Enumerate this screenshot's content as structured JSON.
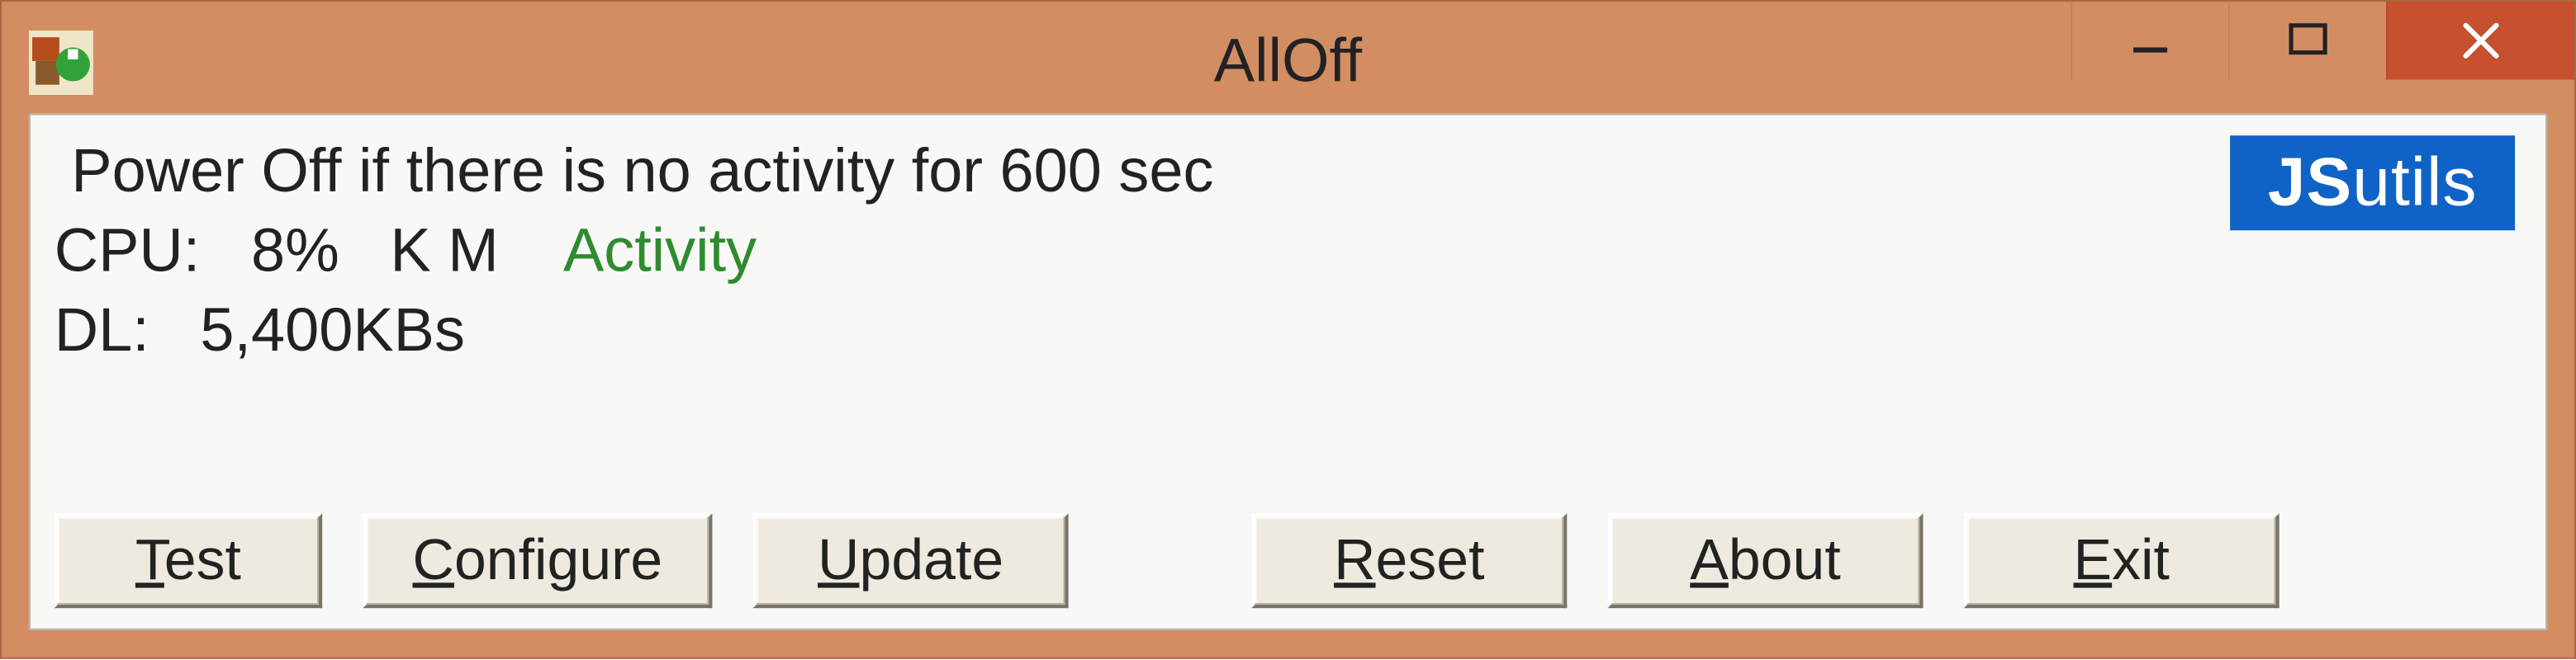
{
  "window": {
    "title": "AllOff"
  },
  "status": {
    "line1": "Power Off if there is no activity for 600 sec",
    "cpu_label": "CPU:",
    "cpu_value": "8%",
    "km": "K M",
    "activity": "Activity",
    "dl_label": "DL:",
    "dl_value": "5,400KBs"
  },
  "logo": {
    "bold": "JS",
    "light": "utils"
  },
  "buttons": {
    "test": {
      "u": "T",
      "rest": "est"
    },
    "configure": {
      "u": "C",
      "rest": "onfigure"
    },
    "update": {
      "u": "U",
      "rest": "pdate"
    },
    "reset": {
      "u": "R",
      "rest": "eset"
    },
    "about": {
      "u": "A",
      "rest": "bout"
    },
    "exit": {
      "u": "E",
      "rest": "xit"
    }
  }
}
